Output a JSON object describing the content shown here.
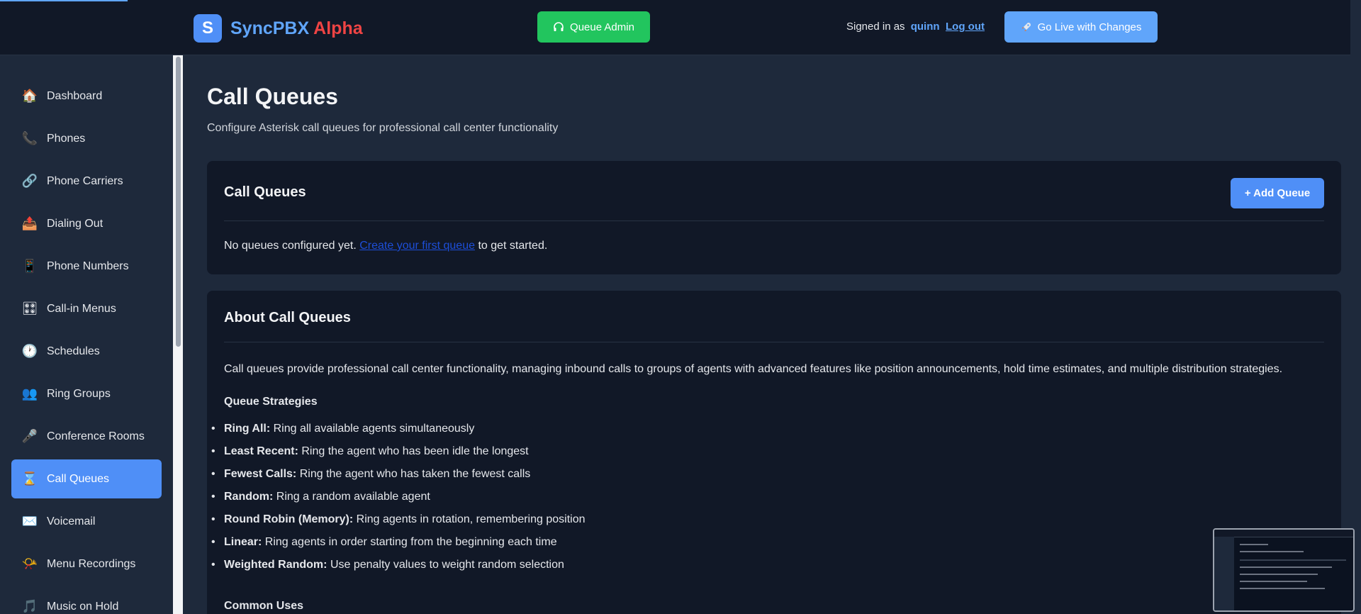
{
  "header": {
    "logo_letter": "S",
    "brand_name": "SyncPBX",
    "brand_accent": "Alpha",
    "queue_admin": {
      "icon": "headphones-icon",
      "label": "Queue Admin"
    },
    "signed_in_text": "Signed in as",
    "username": "quinn",
    "logout": "Log out",
    "go_live": {
      "icon": "rocket-icon",
      "label": "Go Live with Changes"
    }
  },
  "sidebar": {
    "items": [
      {
        "icon": "🏠",
        "label": "Dashboard"
      },
      {
        "icon": "📞",
        "label": "Phones"
      },
      {
        "icon": "🔗",
        "label": "Phone Carriers"
      },
      {
        "icon": "📤",
        "label": "Dialing Out"
      },
      {
        "icon": "📱",
        "label": "Phone Numbers"
      },
      {
        "icon": "🎛",
        "label": "Call-in Menus"
      },
      {
        "icon": "🕐",
        "label": "Schedules"
      },
      {
        "icon": "👥",
        "label": "Ring Groups"
      },
      {
        "icon": "🎤",
        "label": "Conference Rooms"
      },
      {
        "icon": "⌛",
        "label": "Call Queues",
        "active": true
      },
      {
        "icon": "✉️",
        "label": "Voicemail"
      },
      {
        "icon": "📯",
        "label": "Menu Recordings"
      },
      {
        "icon": "🎵",
        "label": "Music on Hold"
      }
    ]
  },
  "main": {
    "title": "Call Queues",
    "subtitle": "Configure Asterisk call queues for professional call center functionality",
    "queues_card": {
      "title": "Call Queues",
      "add_button": "+ Add Queue",
      "empty_prefix": "No queues configured yet.",
      "empty_link": "Create your first queue",
      "empty_suffix": "to get started."
    },
    "about_card": {
      "title": "About Call Queues",
      "description": "Call queues provide professional call center functionality, managing inbound calls to groups of agents with advanced features like position announcements, hold time estimates, and multiple distribution strategies.",
      "strategies_heading": "Queue Strategies",
      "strategies": [
        {
          "name": "Ring All:",
          "desc": "Ring all available agents simultaneously"
        },
        {
          "name": "Least Recent:",
          "desc": "Ring the agent who has been idle the longest"
        },
        {
          "name": "Fewest Calls:",
          "desc": "Ring the agent who has taken the fewest calls"
        },
        {
          "name": "Random:",
          "desc": "Ring a random available agent"
        },
        {
          "name": "Round Robin (Memory):",
          "desc": "Ring agents in rotation, remembering position"
        },
        {
          "name": "Linear:",
          "desc": "Ring agents in order starting from the beginning each time"
        },
        {
          "name": "Weighted Random:",
          "desc": "Use penalty values to weight random selection"
        }
      ],
      "common_uses_heading": "Common Uses"
    }
  }
}
